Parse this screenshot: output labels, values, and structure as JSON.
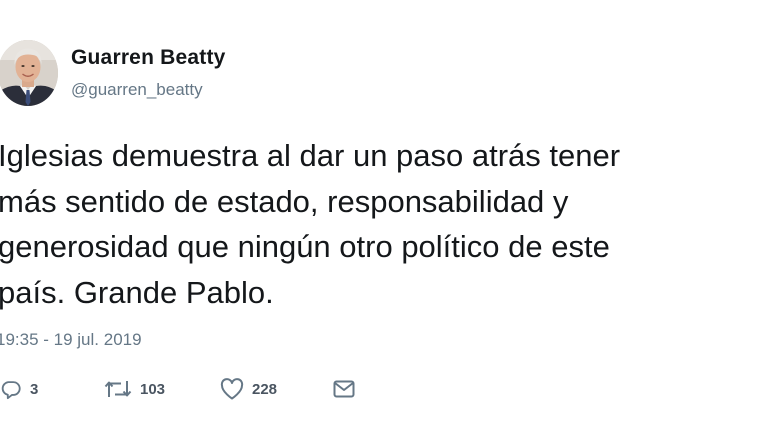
{
  "author": {
    "name": "Guarren Beatty",
    "handle": "@guarren_beatty"
  },
  "tweet": {
    "lines": [
      "Iglesias demuestra al dar un paso atrás tener",
      "más sentido de estado, responsabilidad y",
      "generosidad que ningún otro político de este",
      "país. Grande Pablo."
    ],
    "timestamp": "19:35 - 19 jul. 2019"
  },
  "actions": {
    "replies": {
      "icon": "reply-icon",
      "count": "3"
    },
    "retweets": {
      "icon": "retweet-icon",
      "count": "103"
    },
    "likes": {
      "icon": "heart-icon",
      "count": "228"
    },
    "message": {
      "icon": "envelope-icon"
    }
  },
  "colors": {
    "text": "#14171a",
    "secondary": "#657786",
    "background": "#ffffff"
  }
}
